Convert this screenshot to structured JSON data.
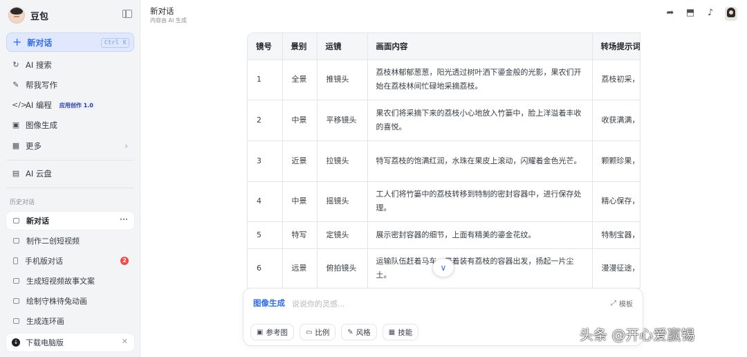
{
  "sidebar": {
    "brand": "豆包",
    "new_chat": {
      "label": "新对话",
      "shortcut": "Ctrl K"
    },
    "menu": [
      {
        "label": "AI 搜索",
        "icon": "search-icon"
      },
      {
        "label": "帮我写作",
        "icon": "pen-icon"
      },
      {
        "label": "AI 编程",
        "icon": "code-icon",
        "badge": "应用创作 1.0"
      },
      {
        "label": "图像生成",
        "icon": "image-icon"
      },
      {
        "label": "更多",
        "icon": "grid-icon"
      },
      {
        "label": "AI 云盘",
        "icon": "cloud-drive-icon"
      }
    ],
    "history_label": "历史对话",
    "history": [
      {
        "label": "新对话",
        "active": true
      },
      {
        "label": "制作二创短视频"
      },
      {
        "label": "手机版对话",
        "badge": "2"
      },
      {
        "label": "生成短视频故事文案"
      },
      {
        "label": "绘制守株待兔动画"
      },
      {
        "label": "生成连环画"
      }
    ],
    "download": "下载电脑版"
  },
  "header": {
    "title": "新对话",
    "subtitle": "内容由 AI 生成"
  },
  "table": {
    "headers": [
      "镜号",
      "景别",
      "运镜",
      "画面内容",
      "转场提示词"
    ],
    "rows": [
      [
        "1",
        "全景",
        "推镜头",
        "荔枝林郁郁葱葱，阳光透过树叶洒下鎏金般的光影，果农们开始在荔枝林间忙碌地采摘荔枝。",
        "荔枝初采，"
      ],
      [
        "2",
        "中景",
        "平移镜头",
        "果农们将采摘下来的荔枝小心地放入竹篓中，脸上洋溢着丰收的喜悦。",
        "收获满满，"
      ],
      [
        "3",
        "近景",
        "拉镜头",
        "特写荔枝的饱满红润，水珠在果皮上滚动，闪耀着金色光芒。",
        "颗颗珍果，"
      ],
      [
        "4",
        "中景",
        "摇镜头",
        "工人们将竹篓中的荔枝转移到特制的密封容器中，进行保存处理。",
        "精心保存，"
      ],
      [
        "5",
        "特写",
        "定镜头",
        "展示密封容器的细节，上面有精美的鎏金花纹。",
        "特制宝器，"
      ],
      [
        "6",
        "远景",
        "俯拍镜头",
        "运输队伍赶着马车，带着装有荔枝的容器出发，扬起一片尘土。",
        "漫漫征途，"
      ]
    ]
  },
  "composer": {
    "mode": "图像生成",
    "placeholder": "说说你的灵感...",
    "template": "模板",
    "tools": [
      "参考图",
      "比例",
      "风格",
      "技能"
    ]
  },
  "watermark": {
    "text": "头条 @开心爱赢锡"
  },
  "colors": {
    "accent": "#2f6bf2",
    "badge_red": "#f5484b"
  }
}
